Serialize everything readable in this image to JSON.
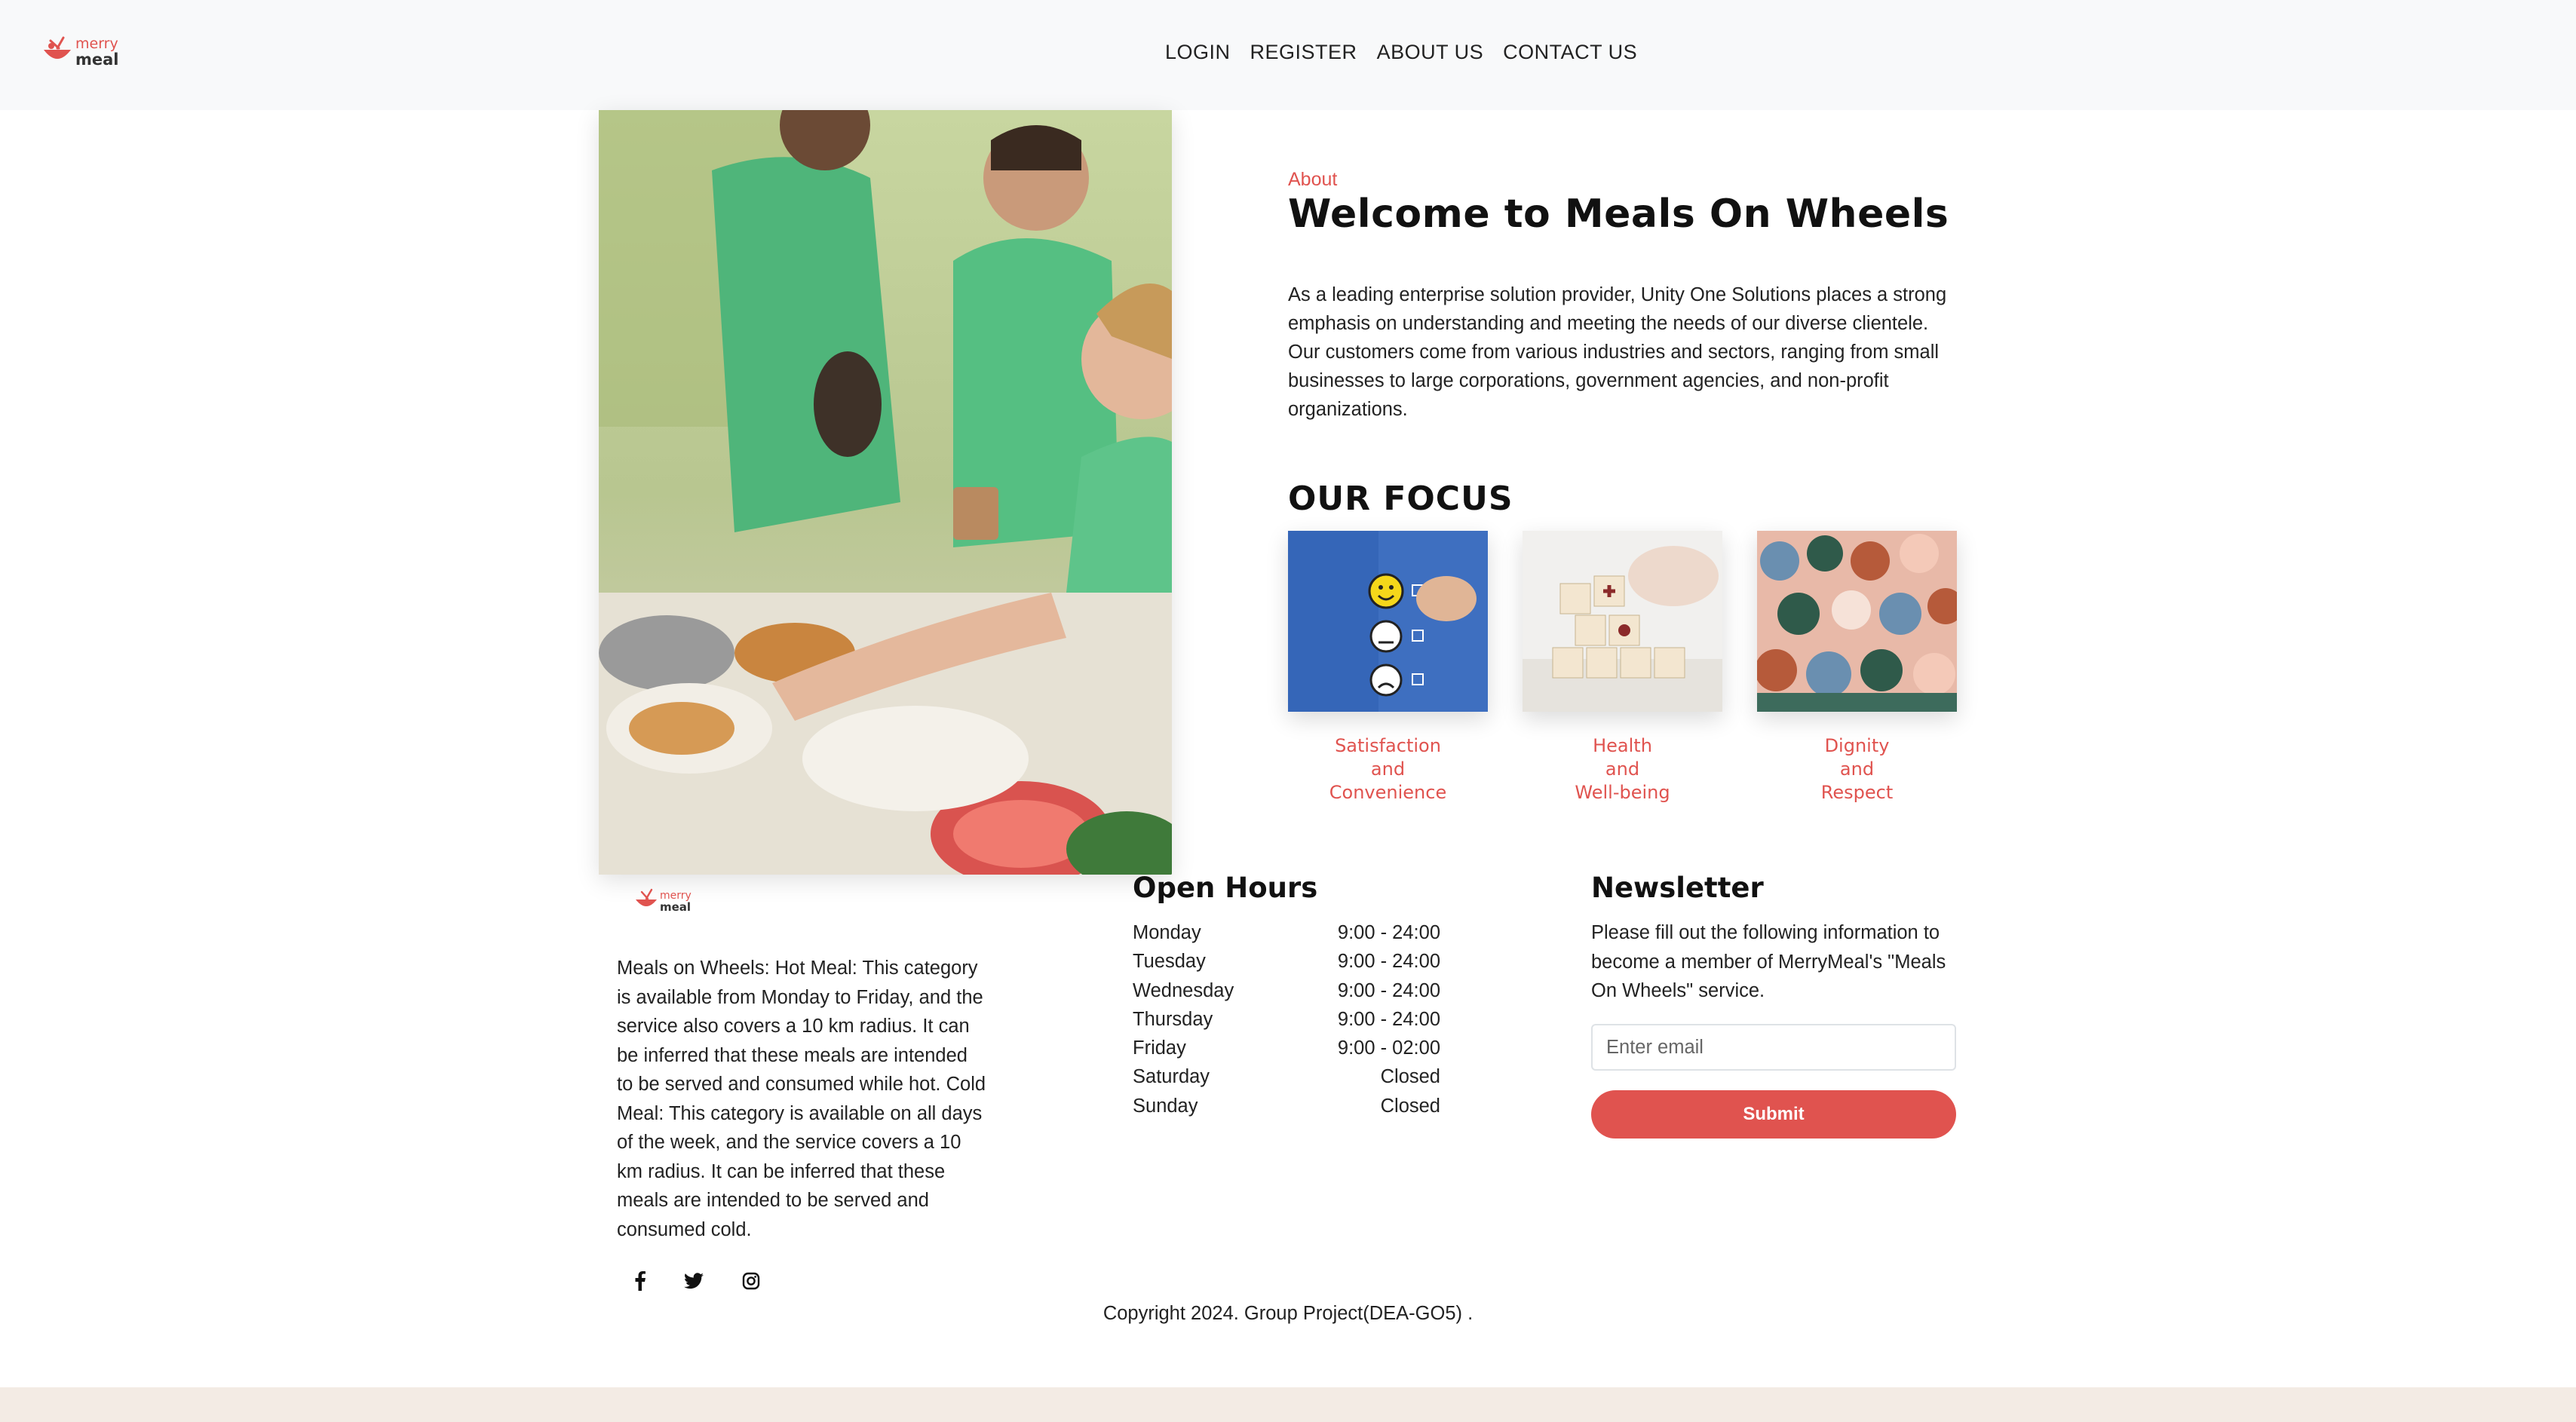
{
  "brand": {
    "logo_top": "merry",
    "logo_bottom": "meal",
    "accent": "#e0534f"
  },
  "nav": {
    "items": [
      "LOGIN",
      "REGISTER",
      "ABOUT US",
      "CONTACT US"
    ]
  },
  "about": {
    "kicker": "About",
    "title": "Welcome to Meals On Wheels",
    "body": "As a leading enterprise solution provider, Unity One Solutions places a strong emphasis on understanding and meeting the needs of our diverse clientele. Our customers come from various industries and sectors, ranging from small businesses to large corporations, government agencies, and non-profit organizations."
  },
  "focus": {
    "title": "OUR FOCUS",
    "items": [
      {
        "line1": "Satisfaction",
        "line2": "and",
        "line3": "Convenience"
      },
      {
        "line1": "Health",
        "line2": "and",
        "line3": "Well-being"
      },
      {
        "line1": "Dignity",
        "line2": "and",
        "line3": "Respect"
      }
    ]
  },
  "footer": {
    "description": "Meals on Wheels: Hot Meal: This category is available from Monday to Friday, and the service also covers a 10 km radius. It can be inferred that these meals are intended to be served and consumed while hot. Cold Meal: This category is available on all days of the week, and the service covers a 10 km radius. It can be inferred that these meals are intended to be served and consumed cold.",
    "social": [
      "facebook-icon",
      "twitter-icon",
      "instagram-icon"
    ],
    "hours_title": "Open Hours",
    "hours": [
      {
        "day": "Monday",
        "time": "9:00 - 24:00"
      },
      {
        "day": "Tuesday",
        "time": "9:00 - 24:00"
      },
      {
        "day": "Wednesday",
        "time": "9:00 - 24:00"
      },
      {
        "day": "Thursday",
        "time": "9:00 - 24:00"
      },
      {
        "day": "Friday",
        "time": "9:00 - 02:00"
      },
      {
        "day": "Saturday",
        "time": "Closed"
      },
      {
        "day": "Sunday",
        "time": "Closed"
      }
    ],
    "newsletter_title": "Newsletter",
    "newsletter_text": "Please fill out the following information to become a member of MerryMeal's \"Meals On Wheels\" service.",
    "email_placeholder": "Enter email",
    "submit_label": "Submit",
    "copyright": "Copyright 2024. Group Project(DEA-GO5) ."
  }
}
